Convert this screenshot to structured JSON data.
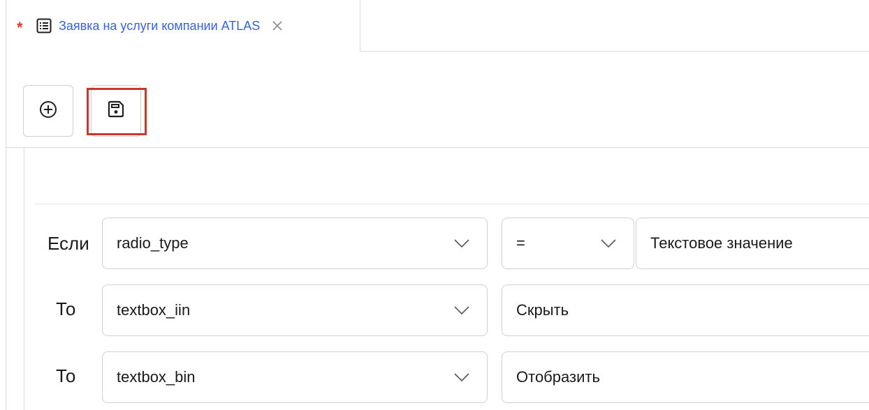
{
  "tab": {
    "modified_marker": "*",
    "title": "Заявка на услуги компании ATLAS"
  },
  "toolbar": {
    "add_icon": "plus-circle-icon",
    "save_icon": "floppy-disk-icon"
  },
  "rules": [
    {
      "label": "Если",
      "field": "radio_type",
      "operator": "=",
      "value": "Текстовое значение"
    },
    {
      "label": "То",
      "field": "textbox_iin",
      "action": "Скрыть"
    },
    {
      "label": "То",
      "field": "textbox_bin",
      "action": "Отобразить"
    }
  ],
  "colors": {
    "accent": "#3a62d8",
    "modified_marker": "#e53935",
    "highlight": "#c9372c"
  }
}
